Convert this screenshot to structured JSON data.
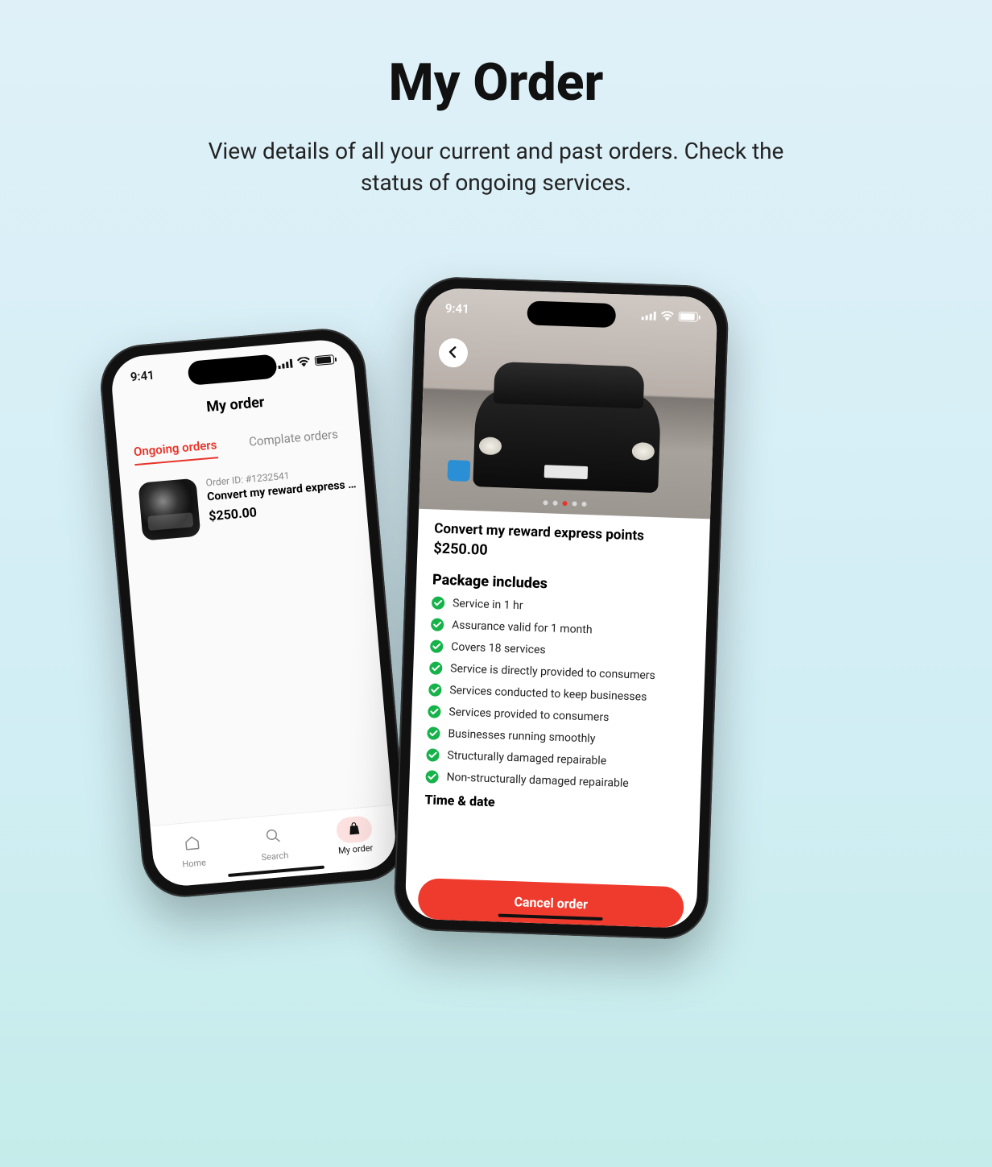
{
  "hero": {
    "title": "My Order",
    "subtitle": "View details of all your current and past orders. Check the status of ongoing services."
  },
  "status": {
    "time": "9:41"
  },
  "left": {
    "header": "My order",
    "tabs": {
      "ongoing": "Ongoing orders",
      "complete": "Complate orders"
    },
    "order": {
      "id_label": "Order ID: #1232541",
      "title": "Convert my reward express po..",
      "price": "$250.00"
    },
    "nav": {
      "home": "Home",
      "search": "Search",
      "myorder": "My order"
    }
  },
  "right": {
    "carousel": {
      "total": 5,
      "active_index": 2
    },
    "title": "Convert my reward express  points",
    "price": "$250.00",
    "package_heading": "Package includes",
    "package_items": [
      "Service  in 1 hr",
      "Assurance valid for 1 month",
      "Covers 18 services",
      "Service is directly provided to consumers",
      "Services conducted to keep businesses",
      "Services provided to consumers",
      "Businesses running smoothly",
      "Structurally damaged repairable",
      "Non-structurally damaged repairable"
    ],
    "time_date_heading": "Time & date",
    "cancel_label": "Cancel order"
  },
  "colors": {
    "accent": "#e8342a",
    "success": "#16b24a"
  }
}
